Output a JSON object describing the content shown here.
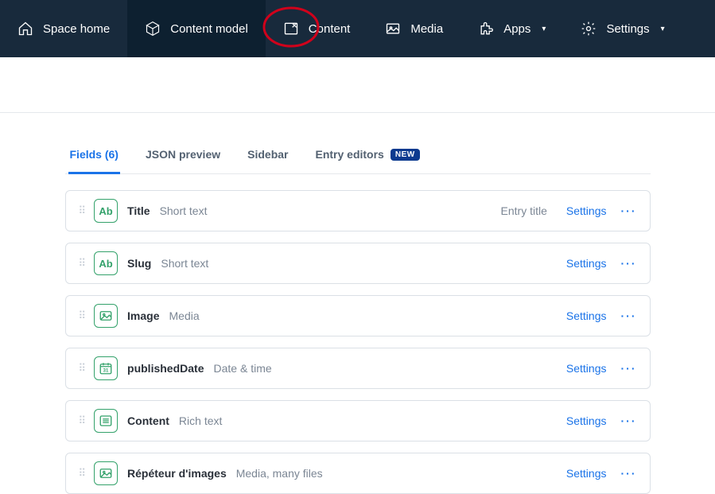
{
  "nav": {
    "space_home": "Space home",
    "content_model": "Content model",
    "content": "Content",
    "media": "Media",
    "apps": "Apps",
    "settings": "Settings"
  },
  "tabs": {
    "fields": "Fields (6)",
    "json_preview": "JSON preview",
    "sidebar": "Sidebar",
    "entry_editors": "Entry editors",
    "new_badge": "NEW"
  },
  "fields": [
    {
      "icon": "Ab",
      "name": "Title",
      "type": "Short text",
      "meta": "Entry title",
      "settings": "Settings"
    },
    {
      "icon": "Ab",
      "name": "Slug",
      "type": "Short text",
      "meta": "",
      "settings": "Settings"
    },
    {
      "icon": "image",
      "name": "Image",
      "type": "Media",
      "meta": "",
      "settings": "Settings"
    },
    {
      "icon": "date",
      "name": "publishedDate",
      "type": "Date & time",
      "meta": "",
      "settings": "Settings"
    },
    {
      "icon": "richtext",
      "name": "Content",
      "type": "Rich text",
      "meta": "",
      "settings": "Settings"
    },
    {
      "icon": "image",
      "name": "Répéteur d'images",
      "type": "Media, many files",
      "meta": "",
      "settings": "Settings"
    }
  ]
}
